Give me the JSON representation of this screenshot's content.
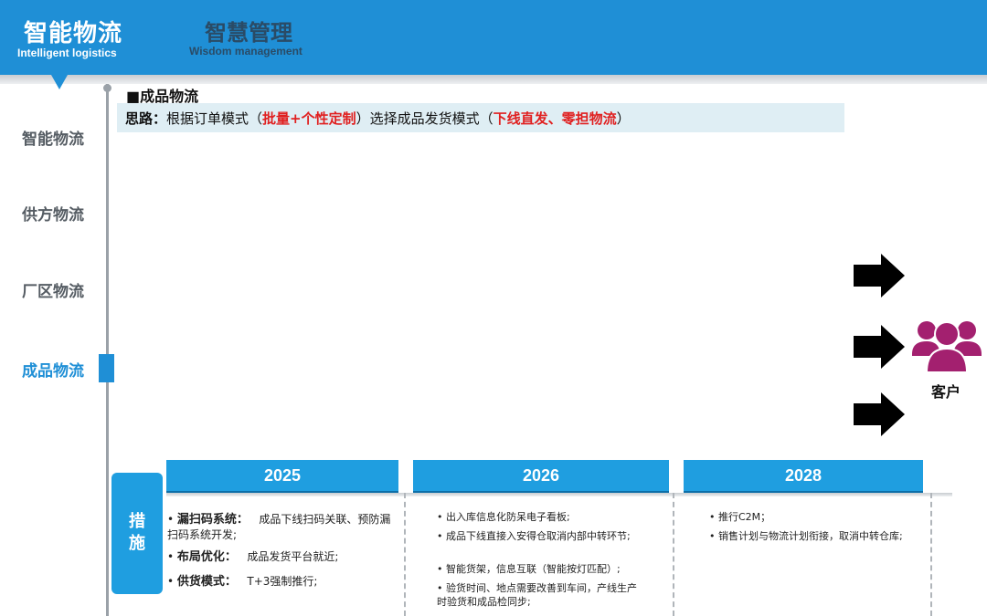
{
  "header": {
    "active_tab": {
      "zh": "智能物流",
      "en": "Intelligent logistics"
    },
    "tab2": {
      "zh": "智慧管理",
      "en": "Wisdom management"
    },
    "color": "#1f8fd6"
  },
  "nav": {
    "items": [
      {
        "label": "智能物流"
      },
      {
        "label": "供方物流"
      },
      {
        "label": "厂区物流"
      },
      {
        "label": "成品物流"
      }
    ],
    "active_index": 3
  },
  "section": {
    "title": "■成品物流",
    "idea_label": "思路：",
    "idea_p1": "根据订单模式（",
    "idea_red1": "批量+个性定制",
    "idea_p2": "）选择成品发货模式（",
    "idea_red2": "下线直发、零担物流",
    "idea_p3": "）"
  },
  "customer": {
    "label": "客户",
    "icon": "people-group-icon",
    "color": "#a3206f"
  },
  "measures": {
    "label": "措施",
    "years": [
      "2025",
      "2026",
      "2028"
    ],
    "col1": [
      {
        "bold": "漏扫码系统：",
        "text": "成品下线扫码关联、预防漏 扫码系统开发;"
      },
      {
        "bold": "布局优化：",
        "text": "成品发货平台就近;"
      },
      {
        "bold": "供货模式：",
        "text": "T+3强制推行;"
      }
    ],
    "col2": [
      "出入库信息化防呆电子看板;",
      "成品下线直接入安得仓取消内部中转环节;",
      "智能货架，信息互联（智能按灯匹配）;",
      "验货时间、地点需要改善到车间，产线生产时验货和成品检同步;"
    ],
    "col3": [
      "推行C2M；",
      "销售计划与物流计划衔接，取消中转仓库;"
    ]
  }
}
